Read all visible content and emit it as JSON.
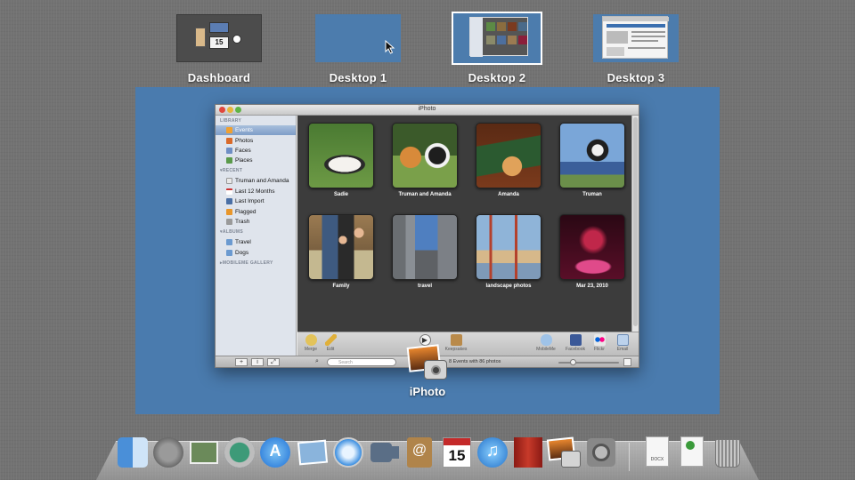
{
  "spaces": [
    {
      "label": "Dashboard",
      "selected": false
    },
    {
      "label": "Desktop 1",
      "selected": false
    },
    {
      "label": "Desktop 2",
      "selected": true
    },
    {
      "label": "Desktop 3",
      "selected": false
    }
  ],
  "dashboard_calendar_day": "15",
  "iphoto": {
    "window_title": "iPhoto",
    "sidebar": {
      "library_heading": "LIBRARY",
      "library": [
        "Events",
        "Photos",
        "Faces",
        "Places"
      ],
      "recent_heading": "RECENT",
      "recent": [
        "Truman and Amanda",
        "Last 12 Months",
        "Last Import",
        "Flagged",
        "Trash"
      ],
      "albums_heading": "ALBUMS",
      "albums": [
        "Travel",
        "Dogs"
      ],
      "mobileme_heading": "MOBILEME GALLERY",
      "selected": "Events"
    },
    "events": [
      {
        "title": "Sadie"
      },
      {
        "title": "Truman and Amanda"
      },
      {
        "title": "Amanda"
      },
      {
        "title": "Truman"
      },
      {
        "title": "Family"
      },
      {
        "title": "travel"
      },
      {
        "title": "landscape photos"
      },
      {
        "title": "Mar 23, 2010"
      }
    ],
    "toolbar": {
      "merge": "Merge",
      "edit": "Edit",
      "keepsakes": "Keepsakes",
      "mobileme": "MobileMe",
      "facebook": "Facebook",
      "flickr": "Flickr",
      "email": "Email"
    },
    "statusbar": {
      "add": "+",
      "info": "i",
      "fullscreen": "⤢",
      "search_placeholder": "Search",
      "status": "8 Events with 86 photos"
    }
  },
  "drag_label": "iPhoto",
  "dock": {
    "items": [
      "finder-icon",
      "launchpad-icon",
      "photo-browser-icon",
      "time-machine-icon",
      "app-store-icon",
      "mail-icon",
      "safari-icon",
      "facetime-icon",
      "address-book-icon",
      "ical-icon",
      "itunes-icon",
      "photo-booth-icon",
      "iphoto-icon",
      "system-preferences-icon",
      "docx-document-icon",
      "document-icon",
      "trash-icon"
    ],
    "ical_day": "15",
    "docx_label": "DOCX"
  }
}
